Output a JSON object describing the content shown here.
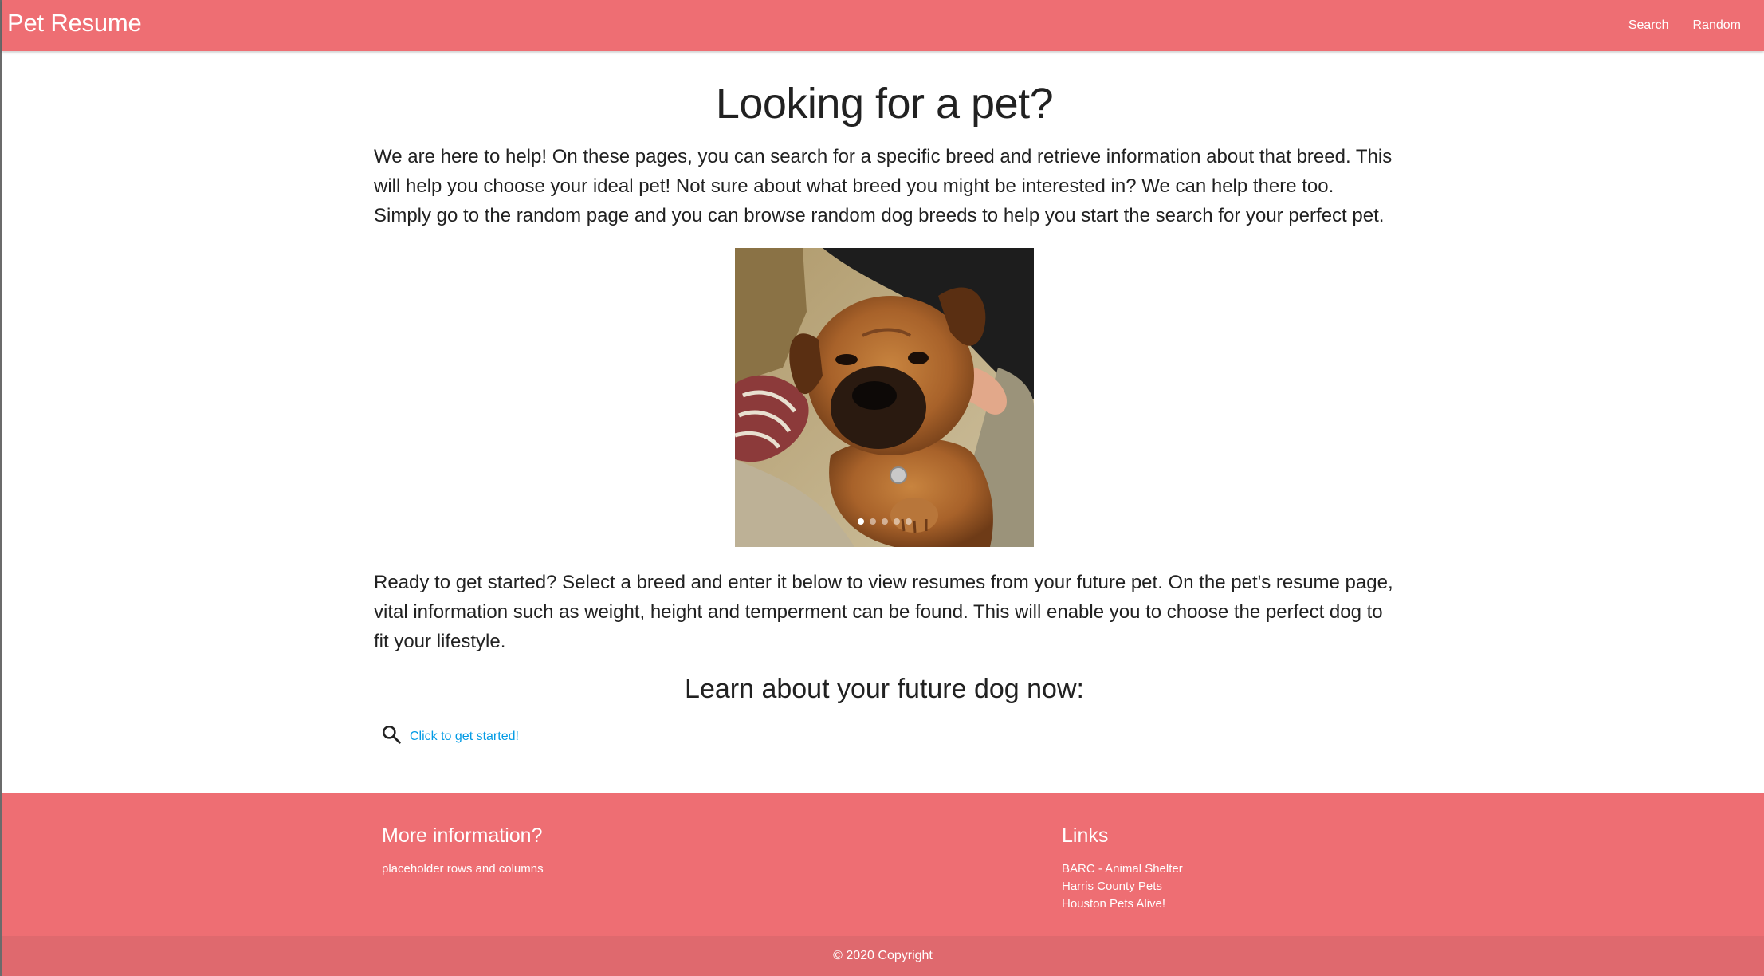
{
  "navbar": {
    "brand": "Pet Resume",
    "links": [
      "Search",
      "Random"
    ],
    "background_color": "#ee6e73"
  },
  "main": {
    "title": "Looking for a pet?",
    "intro": "We are here to help! On these pages, you can search for a specific breed and retrieve information about that breed. This will help you choose your ideal pet! Not sure about what breed you might be interested in? We can help there too. Simply go to the random page and you can browse random dog breeds to help you start the search for your perfect pet.",
    "carousel": {
      "image_subject": "brown puppy lying on a couch",
      "slide_count": 5,
      "active_slide": 1
    },
    "ready_text": "Ready to get started? Select a breed and enter it below to view resumes from your future pet. On the pet's resume page, vital information such as weight, height and temperment can be found. This will enable you to choose the perfect dog to fit your lifestyle.",
    "learn_heading": "Learn about your future dog now:",
    "search": {
      "placeholder": "Click to get started!",
      "icon": "search-icon",
      "accent_color": "#039be5"
    }
  },
  "footer": {
    "left": {
      "heading": "More information?",
      "text": "placeholder rows and columns"
    },
    "right": {
      "heading": "Links",
      "links": [
        "BARC - Animal Shelter",
        "Harris County Pets",
        "Houston Pets Alive!"
      ]
    },
    "copyright": "© 2020 Copyright"
  }
}
